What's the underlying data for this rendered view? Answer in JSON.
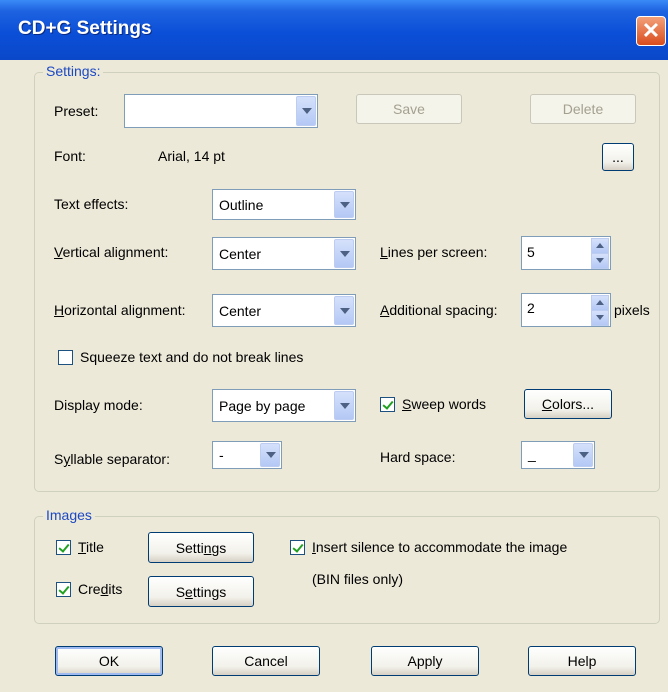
{
  "window": {
    "title": "CD+G Settings",
    "close_glyph": "✕"
  },
  "settings": {
    "legend": "Settings:",
    "preset_label": "Preset:",
    "preset_value": "",
    "save_label": "Save",
    "delete_label": "Delete",
    "font_label": "Font:",
    "font_value": "Arial, 14 pt",
    "font_button_label": "...",
    "text_effects_label": "Text effects:",
    "text_effects_value": "Outline",
    "vertical_alignment_label": "Vertical alignment:",
    "vertical_alignment_value": "Center",
    "lines_per_screen_label": "Lines per screen:",
    "lines_per_screen_value": "5",
    "horizontal_alignment_label": "Horizontal alignment:",
    "horizontal_alignment_value": "Center",
    "additional_spacing_label": "Additional spacing:",
    "additional_spacing_value": "2",
    "pixels_label": "pixels",
    "squeeze_label": "Squeeze text and do not break lines",
    "squeeze_checked": false,
    "display_mode_label": "Display mode:",
    "display_mode_value": "Page by page",
    "sweep_words_label": "Sweep words",
    "sweep_words_checked": true,
    "colors_label": "Colors...",
    "syllable_separator_label": "Syllable separator:",
    "syllable_separator_value": "-",
    "hard_space_label": "Hard space:",
    "hard_space_value": "_"
  },
  "images": {
    "legend": "Images",
    "title_label": "Title",
    "title_checked": true,
    "title_settings_label": "Settings",
    "credits_label": "Credits",
    "credits_checked": true,
    "credits_settings_label": "Settings",
    "insert_silence_label": "Insert silence to accommodate the image",
    "insert_silence_checked": true,
    "bin_note": "(BIN files only)"
  },
  "footer": {
    "ok_label": "OK",
    "cancel_label": "Cancel",
    "apply_label": "Apply",
    "help_label": "Help"
  },
  "colors": {
    "titlebar": "#0B4FD8",
    "dialog_bg": "#ECE9D8",
    "group_legend": "#1C48C4",
    "close_button": "#D94C1E"
  }
}
